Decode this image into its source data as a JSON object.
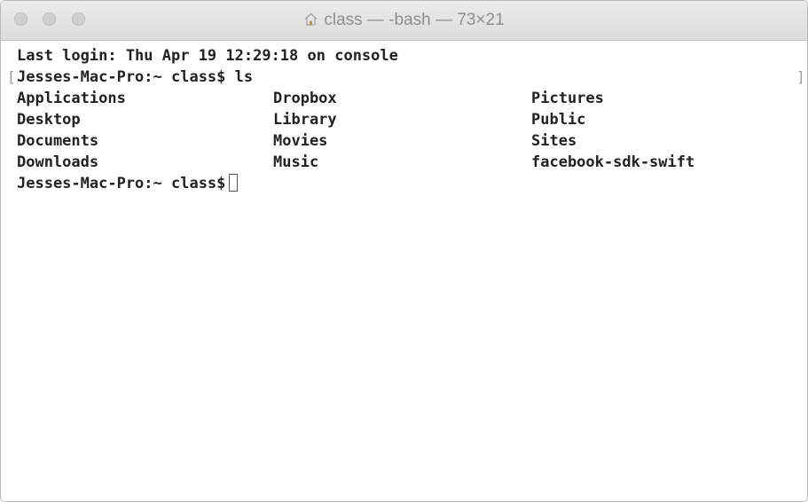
{
  "window": {
    "title": "class — -bash — 73×21"
  },
  "terminal": {
    "last_login": "Last login: Thu Apr 19 12:29:18 on console",
    "prompt": "Jesses-Mac-Pro:~ class$",
    "command": "ls",
    "listing": [
      [
        "Applications",
        "Dropbox",
        "Pictures"
      ],
      [
        "Desktop",
        "Library",
        "Public"
      ],
      [
        "Documents",
        "Movies",
        "Sites"
      ],
      [
        "Downloads",
        "Music",
        "facebook-sdk-swift"
      ]
    ]
  }
}
